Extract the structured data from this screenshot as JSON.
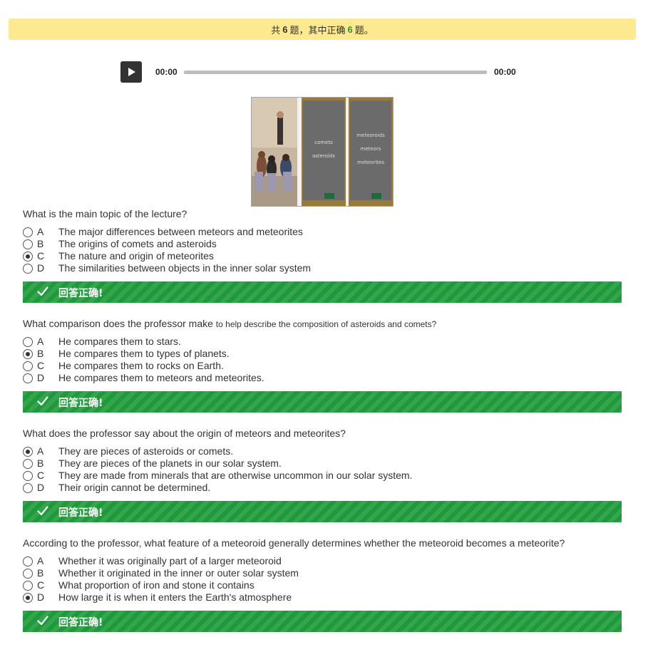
{
  "summary": {
    "prefix": "共",
    "total": "6",
    "middle": "题，其中正确",
    "correct": "6",
    "suffix": "题。"
  },
  "player": {
    "current_time": "00:00",
    "duration": "00:00",
    "progress": 0
  },
  "image": {
    "board1_text": [
      "comets",
      "asteroids"
    ],
    "board2_text": [
      "meteoroids",
      "meteors",
      "meteorites"
    ]
  },
  "result_text": "回答正确!",
  "colors": {
    "summary_bg": "#fde98f",
    "correct_green": "#1e9a37",
    "result_bar": "#1f9a3a"
  },
  "questions": [
    {
      "text": "What is the main topic of the lecture?",
      "text_small": "",
      "selected": "C",
      "options": [
        {
          "letter": "A",
          "text": "The major differences between meteors and meteorites"
        },
        {
          "letter": "B",
          "text": "The origins of comets and asteroids"
        },
        {
          "letter": "C",
          "text": "The nature and origin of meteorites"
        },
        {
          "letter": "D",
          "text": "The similarities between objects in the inner solar system"
        }
      ]
    },
    {
      "text": "What comparison does the professor make ",
      "text_small": "to help describe the composition of asteroids and comets?",
      "selected": "B",
      "options": [
        {
          "letter": "A",
          "text": "He compares them to stars."
        },
        {
          "letter": "B",
          "text": "He compares them to types of planets."
        },
        {
          "letter": "C",
          "text": "He compares them to rocks on Earth."
        },
        {
          "letter": "D",
          "text": "He compares them to meteors and meteorites."
        }
      ]
    },
    {
      "text": "What does the professor say about the origin of meteors and meteorites?",
      "text_small": "",
      "selected": "A",
      "options": [
        {
          "letter": "A",
          "text": "They are pieces of asteroids or comets."
        },
        {
          "letter": "B",
          "text": "They are pieces of the planets in our solar system."
        },
        {
          "letter": "C",
          "text": "They are made from minerals that are otherwise uncommon in our solar system."
        },
        {
          "letter": "D",
          "text": "Their origin cannot be determined."
        }
      ]
    },
    {
      "text": "According to the professor, what feature of a meteoroid generally determines whether the meteoroid becomes a meteorite?",
      "text_small": "",
      "selected": "D",
      "options": [
        {
          "letter": "A",
          "text": "Whether it was originally part of a larger meteoroid"
        },
        {
          "letter": "B",
          "text": "Whether it originated in the inner or outer solar system"
        },
        {
          "letter": "C",
          "text": "What proportion of iron and stone it contains"
        },
        {
          "letter": "D",
          "text": "How large it is when it enters the Earth's atmosphere"
        }
      ]
    }
  ]
}
